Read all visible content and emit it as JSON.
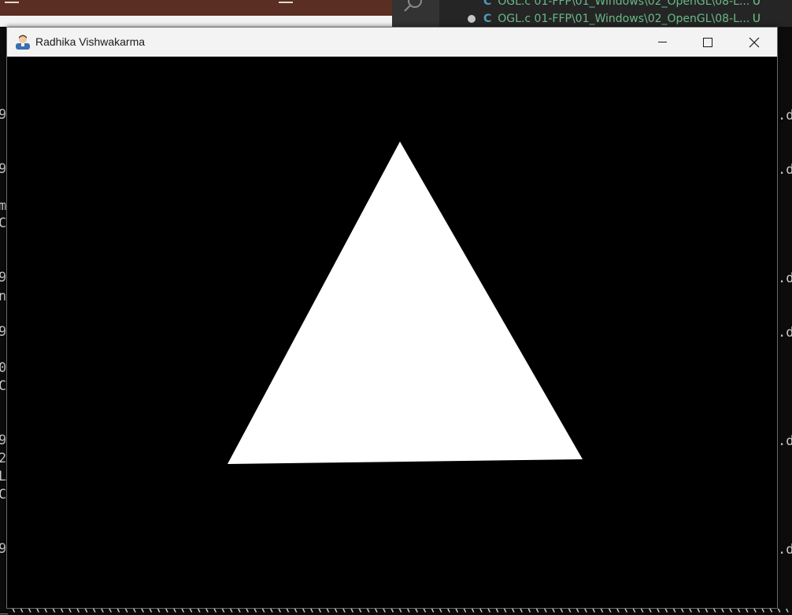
{
  "window": {
    "title": "Radhika Vishwakarma",
    "icon": "user-avatar-icon",
    "buttons": {
      "minimize_icon": "minimize-icon",
      "maximize_icon": "maximize-icon",
      "close_icon": "close-icon"
    }
  },
  "scene": {
    "background_color": "#000000",
    "shape": "triangle",
    "fill_color": "#ffffff"
  },
  "background_editor": {
    "rows": [
      {
        "text": "OGL.c  01-FFP\\01_Windows\\02_OpenGL\\08-L...",
        "status": "U"
      },
      {
        "text": "OGL.c  01-FFP\\01_Windows\\02_OpenGL\\08-L...",
        "status": "U"
      }
    ]
  },
  "background_terminal": {
    "left_chars": [
      "9",
      "9",
      "m",
      "C",
      "9",
      "n",
      "9",
      "0",
      "C",
      "9",
      "2",
      "L",
      "C",
      "9"
    ],
    "right_chars": [
      ".d",
      ".d",
      ".d",
      ".d",
      ".d",
      ".d"
    ]
  }
}
